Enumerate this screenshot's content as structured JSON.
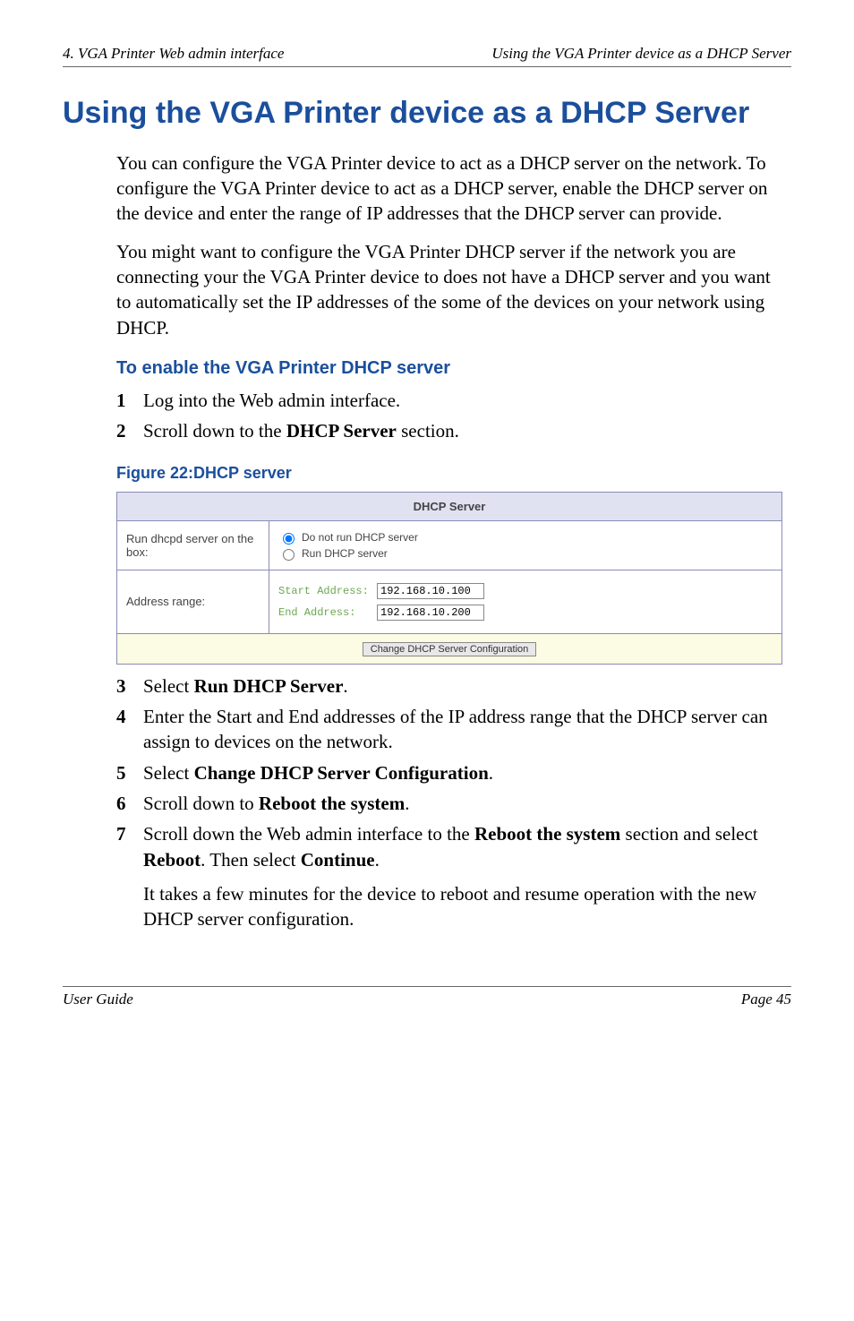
{
  "header": {
    "left": "4. VGA Printer Web admin interface",
    "right": "Using the VGA Printer device as a DHCP Server"
  },
  "title": "Using the VGA Printer device as a DHCP Server",
  "para1": "You can configure the VGA Printer device to act as a DHCP server on the network. To configure the VGA Printer device to act as a DHCP server, enable the DHCP server on the device and enter the range of IP addresses that the DHCP server can provide.",
  "para2": "You might want to configure the VGA Printer DHCP server if the network you are connecting your the VGA Printer device to does not have a DHCP server and you want to automatically set the IP addresses of the some of the devices on your network using DHCP.",
  "sub1": "To enable the VGA Printer DHCP server",
  "steps_a": [
    {
      "n": "1",
      "t": "Log into the Web admin interface."
    },
    {
      "n": "2",
      "pre": "Scroll down to the ",
      "bold": "DHCP Server",
      "post": " section."
    }
  ],
  "fig_caption": "Figure 22:DHCP server",
  "dhcp": {
    "header": "DHCP Server",
    "row1_label": "Run dhcpd server on the box:",
    "opt1": "Do not run DHCP server",
    "opt2": "Run DHCP server",
    "row2_label": "Address range:",
    "start_label": "Start Address:",
    "start_val": "192.168.10.100",
    "end_label": "End Address:",
    "end_val": "192.168.10.200",
    "button": "Change DHCP Server Configuration"
  },
  "steps_b": [
    {
      "n": "3",
      "pre": "Select ",
      "bold": "Run DHCP Server",
      "post": "."
    },
    {
      "n": "4",
      "t": "Enter the Start and End addresses of the IP address range that the DHCP server can assign to devices on the network."
    },
    {
      "n": "5",
      "pre": "Select ",
      "bold": "Change DHCP Server Configuration",
      "post": "."
    },
    {
      "n": "6",
      "pre": "Scroll down to ",
      "bold": "Reboot the system",
      "post": "."
    },
    {
      "n": "7",
      "parts": [
        {
          "t": "Scroll down the Web admin interface to the "
        },
        {
          "b": "Reboot the system"
        },
        {
          "t": " section and select "
        },
        {
          "b": "Reboot"
        },
        {
          "t": ". Then select "
        },
        {
          "b": "Continue"
        },
        {
          "t": "."
        }
      ]
    }
  ],
  "tail_para": "It takes a few minutes for the device to reboot and resume operation with the new DHCP server configuration.",
  "footer": {
    "left": "User Guide",
    "right": "Page 45"
  }
}
